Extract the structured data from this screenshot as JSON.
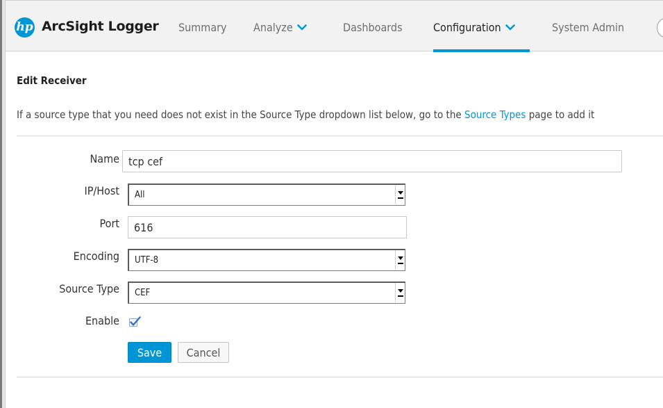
{
  "header": {
    "logo_text": "hp",
    "app_title": "ArcSight Logger",
    "nav": [
      {
        "label": "Summary"
      },
      {
        "label": "Analyze"
      },
      {
        "label": "Dashboards"
      },
      {
        "label": "Configuration"
      },
      {
        "label": "System Admin"
      }
    ],
    "active_nav": "Configuration",
    "accent_color": "#0096d6"
  },
  "page": {
    "title": "Edit Receiver",
    "info_prefix": "If a source type that you need does not exist in the Source Type dropdown list below, go to the ",
    "info_link": "Source Types",
    "info_suffix": " page to add it"
  },
  "form": {
    "name": {
      "label": "Name",
      "value": "tcp cef"
    },
    "ip_host": {
      "label": "IP/Host",
      "value": "All"
    },
    "port": {
      "label": "Port",
      "value": "616"
    },
    "encoding": {
      "label": "Encoding",
      "value": "UTF-8"
    },
    "source_type": {
      "label": "Source Type",
      "value": "CEF"
    },
    "enable": {
      "label": "Enable",
      "checked": true
    }
  },
  "buttons": {
    "save": "Save",
    "cancel": "Cancel"
  }
}
